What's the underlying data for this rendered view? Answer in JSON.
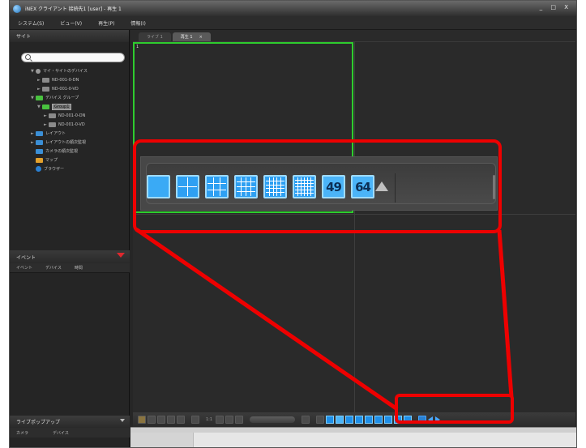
{
  "window": {
    "title": "iNEX クライアント 接続先1 [user] - 再生 1",
    "controls": "_ □ X"
  },
  "menu": [
    {
      "label": "システム(S)"
    },
    {
      "label": "ビュー(V)"
    },
    {
      "label": "再生(P)"
    },
    {
      "label": "情報(I)"
    }
  ],
  "sidebar": {
    "site_header": "サイト",
    "search_placeholder": "",
    "tree": [
      {
        "label": "マイ・サイトのデバイス",
        "indent": 0,
        "icon": "site-icon",
        "twisty": "▼"
      },
      {
        "label": "ND-001-0-DN",
        "indent": 1,
        "icon": "device-icon",
        "twisty": "►"
      },
      {
        "label": "ND-001-0-VD",
        "indent": 1,
        "icon": "device-icon",
        "twisty": "►"
      },
      {
        "label": "デバイス グループ",
        "indent": 0,
        "icon": "group-icon",
        "twisty": "▼"
      },
      {
        "label": "Group1",
        "indent": 1,
        "icon": "group-icon",
        "twisty": "▼",
        "highlight": true
      },
      {
        "label": "ND-001-0-DN",
        "indent": 2,
        "icon": "device-icon",
        "twisty": "►"
      },
      {
        "label": "ND-001-0-VD",
        "indent": 2,
        "icon": "device-icon",
        "twisty": "►"
      },
      {
        "label": "レイアウト",
        "indent": 0,
        "icon": "layout-icon",
        "twisty": "►"
      },
      {
        "label": "レイアウトの順次監視",
        "indent": 0,
        "icon": "layout-icon",
        "twisty": "►"
      },
      {
        "label": "カメラの順次監視",
        "indent": 0,
        "icon": "layout-icon",
        "twisty": ""
      },
      {
        "label": "マップ",
        "indent": 0,
        "icon": "map-icon",
        "twisty": ""
      },
      {
        "label": "ブラウザー",
        "indent": 0,
        "icon": "browser-icon",
        "twisty": ""
      }
    ],
    "event_panel": {
      "header": "イベント",
      "columns": [
        "イベント",
        "デバイス",
        "時間"
      ]
    },
    "playback_panel": {
      "header": "ライブポップアップ",
      "columns": [
        "カメラ",
        "デバイス"
      ]
    }
  },
  "tabs": [
    {
      "label": "ライブ 1",
      "active": false
    },
    {
      "label": "再生 1",
      "active": true,
      "close": "×"
    }
  ],
  "video": {
    "selected_cell_number": "1"
  },
  "toolbar": {
    "time_label": "1:1"
  },
  "layout_panel": {
    "buttons": [
      {
        "name": "layout-1x1-button",
        "grid": 1
      },
      {
        "name": "layout-2x2-button",
        "grid": 2
      },
      {
        "name": "layout-3x3-button",
        "grid": 3
      },
      {
        "name": "layout-4x4-button",
        "grid": 4
      },
      {
        "name": "layout-5x5-button",
        "grid": 5
      },
      {
        "name": "layout-6x6-button",
        "grid": 6
      },
      {
        "name": "layout-49-button",
        "label": "49"
      },
      {
        "name": "layout-64-button",
        "label": "64"
      }
    ]
  },
  "colors": {
    "callout": "#ee0000",
    "selected_cell": "#2ecc2e",
    "layout_button": "#2ea0f2"
  }
}
